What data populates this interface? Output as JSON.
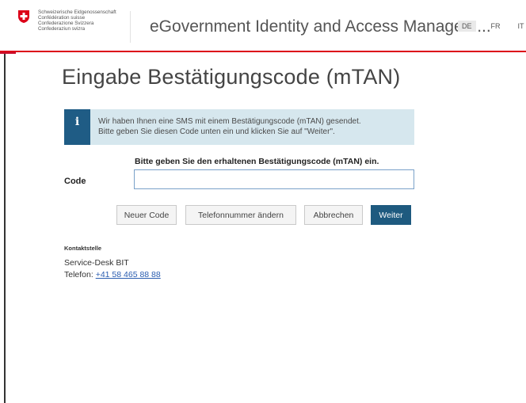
{
  "header": {
    "agency_lines": [
      "Schweizerische Eidgenossenschaft",
      "Confédération suisse",
      "Confederazione Svizzera",
      "Confederaziun svizra"
    ],
    "app_title": "eGovernment Identity and Access Managem...",
    "languages": [
      "DE",
      "FR",
      "IT"
    ],
    "active_language": "DE"
  },
  "page": {
    "title": "Eingabe Bestätigungscode (mTAN)"
  },
  "info": {
    "icon": "info-icon",
    "line1": "Wir haben Ihnen eine SMS mit einem Bestätigungscode (mTAN) gesendet.",
    "line2": "Bitte geben Sie diesen Code unten ein und klicken Sie auf \"Weiter\"."
  },
  "form": {
    "prompt": "Bitte geben Sie den erhaltenen Bestätigungscode (mTAN) ein.",
    "code_label": "Code",
    "code_value": ""
  },
  "buttons": {
    "new_code": "Neuer Code",
    "change_phone": "Telefonnummer ändern",
    "cancel": "Abbrechen",
    "next": "Weiter"
  },
  "contact": {
    "title": "Kontaktstelle",
    "name": "Service-Desk BIT",
    "phone_label": "Telefon:",
    "phone_number": "+41 58 465 88 88"
  },
  "colors": {
    "swiss_red": "#dc0018",
    "primary_blue": "#1e5a7f",
    "info_bg": "#d6e7ee"
  }
}
